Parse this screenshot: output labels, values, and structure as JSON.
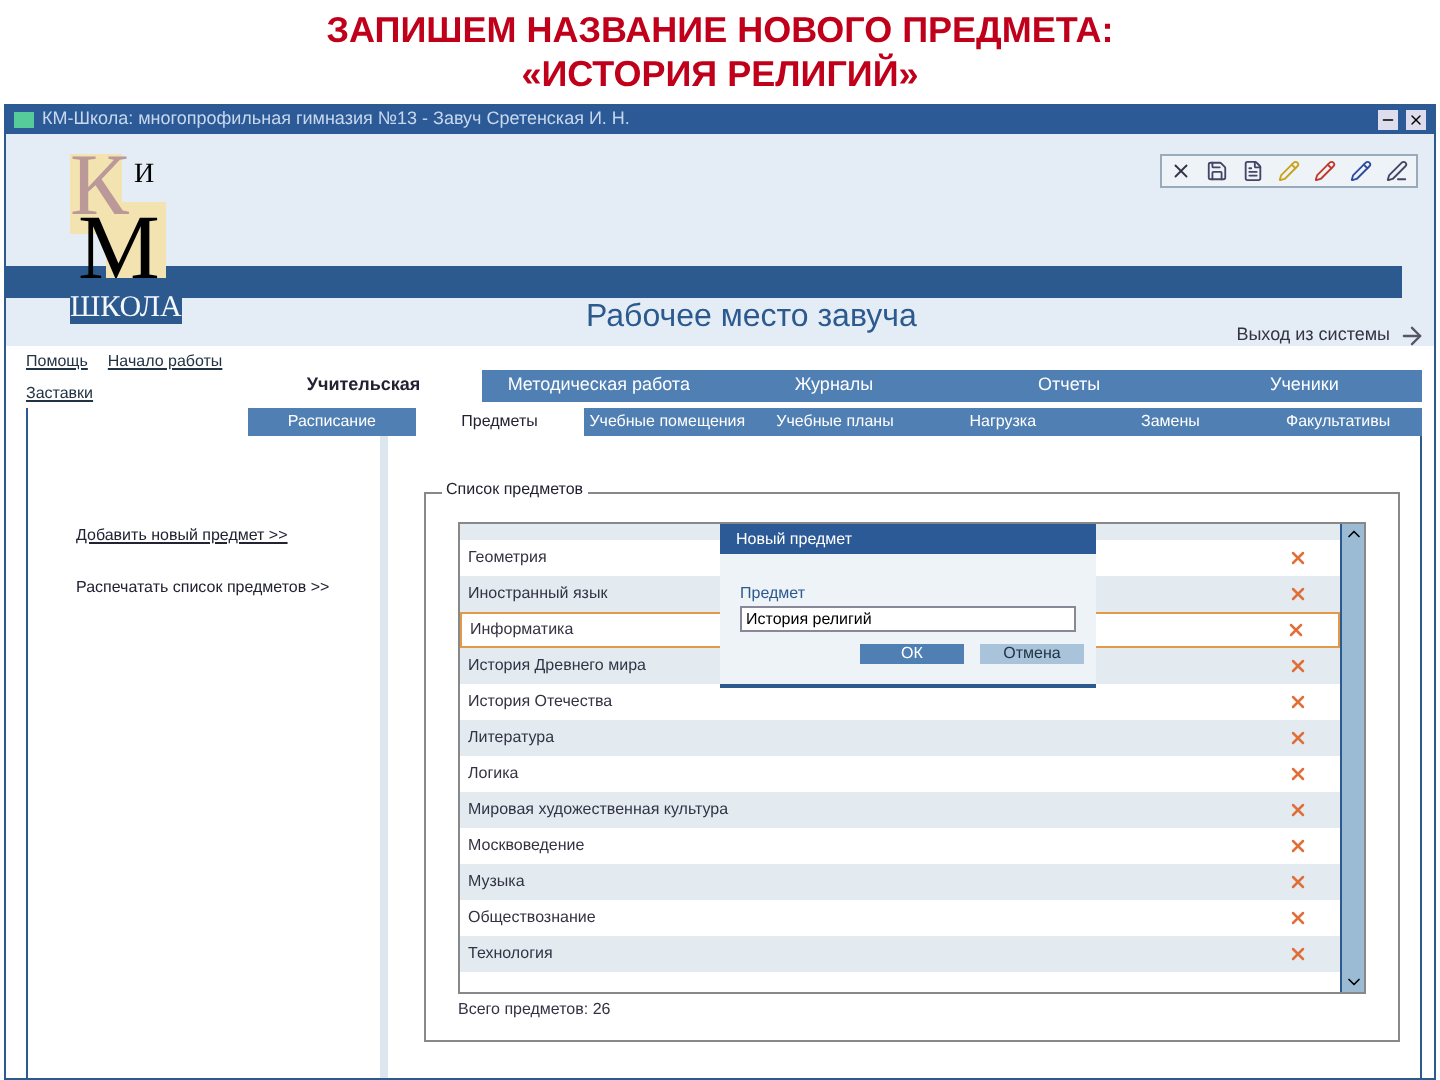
{
  "slide_title": [
    "ЗАПИШЕМ НАЗВАНИЕ НОВОГО ПРЕДМЕТА:",
    "«ИСТОРИЯ РЕЛИГИЙ»"
  ],
  "window": {
    "title": "КМ-Школа: многопрофильная гимназия №13 - Завуч Сретенская И. Н."
  },
  "logo": {
    "letters": [
      "К",
      "И",
      "М"
    ],
    "caption": "ШКОЛА"
  },
  "header": {
    "title": "Рабочее место завуча",
    "exit": "Выход из системы"
  },
  "links": [
    "Помощь",
    "Начало работы",
    "Заставки"
  ],
  "tabs": [
    {
      "label": "Учительская",
      "selected": true
    },
    {
      "label": "Методическая работа",
      "selected": false
    },
    {
      "label": "Журналы",
      "selected": false
    },
    {
      "label": "Отчеты",
      "selected": false
    },
    {
      "label": "Ученики",
      "selected": false
    }
  ],
  "subtabs": [
    {
      "label": "Расписание",
      "selected": false
    },
    {
      "label": "Предметы",
      "selected": true
    },
    {
      "label": "Учебные помещения",
      "selected": false
    },
    {
      "label": "Учебные планы",
      "selected": false
    },
    {
      "label": "Нагрузка",
      "selected": false
    },
    {
      "label": "Замены",
      "selected": false
    },
    {
      "label": "Факультативы",
      "selected": false
    }
  ],
  "side_links": [
    {
      "label": "Добавить новый предмет >>",
      "underlined": true
    },
    {
      "label": "Распечатать список предметов >>",
      "underlined": false
    }
  ],
  "subjects": {
    "title": "Список предметов",
    "rows": [
      {
        "name": "Геометрия",
        "selected": false
      },
      {
        "name": "Иностранный язык",
        "selected": false
      },
      {
        "name": "Информатика",
        "selected": true
      },
      {
        "name": "История Древнего мира",
        "selected": false
      },
      {
        "name": "История Отечества",
        "selected": false
      },
      {
        "name": "Литература",
        "selected": false
      },
      {
        "name": "Логика",
        "selected": false
      },
      {
        "name": "Мировая художественная культура",
        "selected": false
      },
      {
        "name": "Москвоведение",
        "selected": false
      },
      {
        "name": "Музыка",
        "selected": false
      },
      {
        "name": "Обществознание",
        "selected": false
      },
      {
        "name": "Технология",
        "selected": false
      }
    ],
    "total": "Всего предметов: 26"
  },
  "dialog": {
    "title": "Новый предмет",
    "label": "Предмет",
    "value": "История религий",
    "buttons": [
      "ОК",
      "Отмена"
    ]
  }
}
